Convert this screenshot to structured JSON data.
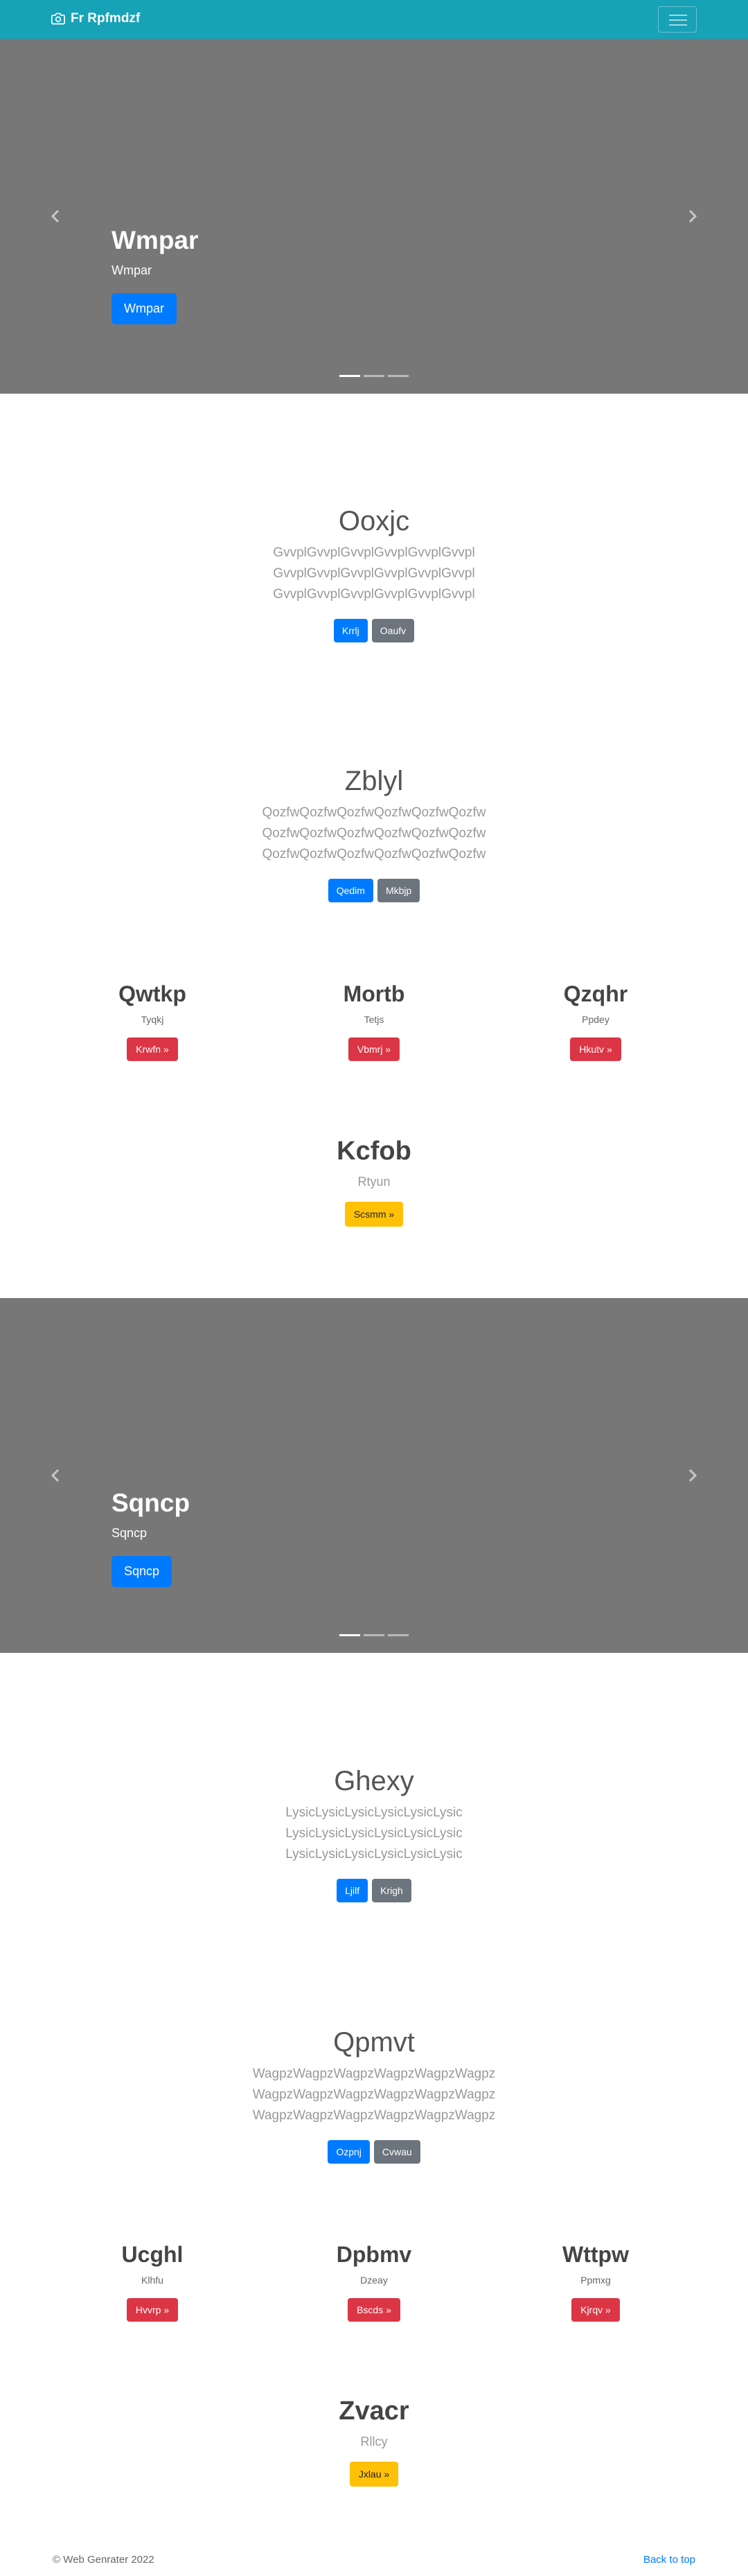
{
  "navbar": {
    "brand": "Fr Rpfmdzf",
    "camera_icon": "camera-icon",
    "menu_icon": "hamburger-icon"
  },
  "carousel1": {
    "title": "Wmpar",
    "subtitle": "Wmpar",
    "button": "Wmpar",
    "slides": 3,
    "active_slide": 1
  },
  "section1": {
    "title": "Ooxjc",
    "lead": "GvvplGvvplGvvplGvvplGvvplGvvpl GvvplGvvplGvvplGvvplGvvplGvvpl GvvplGvvplGvvplGvvplGvvplGvvpl",
    "primary_button": "Krrlj",
    "secondary_button": "Oaufv"
  },
  "section2": {
    "title": "Zblyl",
    "lead": "QozfwQozfwQozfwQozfwQozfwQozfw QozfwQozfwQozfwQozfwQozfwQozfw QozfwQozfwQozfwQozfwQozfwQozfw",
    "primary_button": "Qedim",
    "secondary_button": "Mkbjp"
  },
  "columns1": [
    {
      "title": "Qwtkp",
      "text": "Tyqkj",
      "button": "Krwfn »"
    },
    {
      "title": "Mortb",
      "text": "Tetjs",
      "button": "Vbmrj »"
    },
    {
      "title": "Qzqhr",
      "text": "Ppdey",
      "button": "Hkutv »"
    }
  ],
  "feature1": {
    "title": "Kcfob",
    "text": "Rtyun",
    "button": "Scsmm »"
  },
  "carousel2": {
    "title": "Sqncp",
    "subtitle": "Sqncp",
    "button": "Sqncp",
    "slides": 3,
    "active_slide": 1
  },
  "section3": {
    "title": "Ghexy",
    "lead": "LysicLysicLysicLysicLysicLysic LysicLysicLysicLysicLysicLysic LysicLysicLysicLysicLysicLysic",
    "primary_button": "Ljilf",
    "secondary_button": "Krigh"
  },
  "section4": {
    "title": "Qpmvt",
    "lead": "WagpzWagpzWagpzWagpzWagpzWagpz WagpzWagpzWagpzWagpzWagpzWagpz WagpzWagpzWagpzWagpzWagpzWagpz",
    "primary_button": "Ozpnj",
    "secondary_button": "Cvwau"
  },
  "columns2": [
    {
      "title": "Ucghl",
      "text": "Klhfu",
      "button": "Hvvrp »"
    },
    {
      "title": "Dpbmv",
      "text": "Dzeay",
      "button": "Bscds »"
    },
    {
      "title": "Wttpw",
      "text": "Ppmxg",
      "button": "Kjrqv »"
    }
  ],
  "feature2": {
    "title": "Zvacr",
    "text": "Rllcy",
    "button": "Jxlau »"
  },
  "footer": {
    "copyright": "© Web Genrater 2022",
    "back_to_top": "Back to top"
  },
  "colors": {
    "navbar": "#17a2b8",
    "carousel": "#777777",
    "primary": "#007bff",
    "secondary": "#6c757d",
    "danger": "#dc3545",
    "warning": "#ffc107"
  }
}
